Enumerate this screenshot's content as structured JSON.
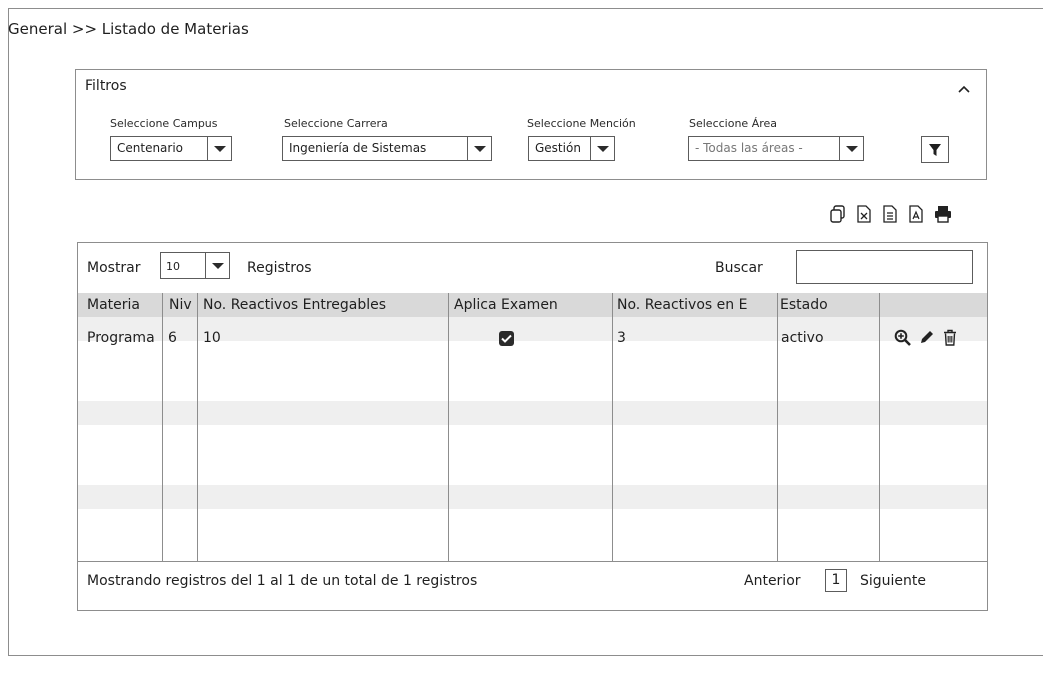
{
  "breadcrumb": "General >> Listado de Materias",
  "filters": {
    "title": "Filtros",
    "collapse_icon": "chevron-up-icon",
    "campus": {
      "label": "Seleccione Campus",
      "value": "Centenario"
    },
    "carrera": {
      "label": "Seleccione Carrera",
      "value": "Ingeniería de Sistemas"
    },
    "mencion": {
      "label": "Seleccione Mención",
      "value": "Gestión"
    },
    "area": {
      "label": "Seleccione Área",
      "value": "- Todas las áreas -"
    },
    "apply_icon": "filter-icon"
  },
  "toolbar": {
    "icons": [
      "copy-icon",
      "excel-icon",
      "csv-icon",
      "pdf-icon",
      "print-icon"
    ]
  },
  "table": {
    "mostrar_label": "Mostrar",
    "page_size": "10",
    "registros_label": "Registros",
    "buscar_label": "Buscar",
    "search_value": "",
    "columns": [
      "Materia",
      "Niv",
      "No. Reactivos Entregables",
      "Aplica Examen",
      "No. Reactivos en E",
      "Estado"
    ],
    "rows": [
      {
        "materia": "Programa",
        "nivel": "6",
        "reactivos_entregables": "10",
        "aplica_examen": true,
        "reactivos_examen": "3",
        "estado": "activo",
        "actions": [
          "zoom-in-icon",
          "pencil-icon",
          "trash-icon"
        ]
      }
    ],
    "footer_text": "Mostrando registros del 1 al 1 de un total de 1 registros",
    "prev_label": "Anterior",
    "current_page": "1",
    "next_label": "Siguiente"
  }
}
